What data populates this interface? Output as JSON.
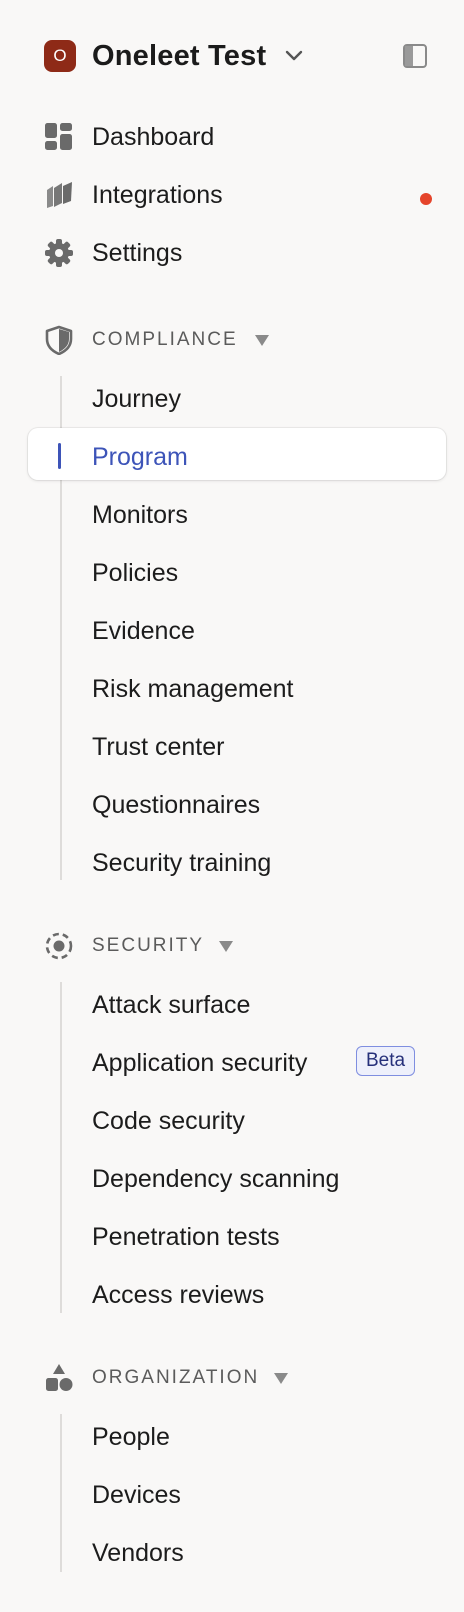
{
  "workspace": {
    "initial": "O",
    "name": "Oneleet Test",
    "chevron_icon": "chevron-down-icon",
    "toggle_icon": "sidebar-toggle-icon"
  },
  "nav": {
    "dashboard": "Dashboard",
    "integrations": "Integrations",
    "settings": "Settings"
  },
  "compliance": {
    "title": "COMPLIANCE",
    "items": [
      "Journey",
      "Program",
      "Monitors",
      "Policies",
      "Evidence",
      "Risk management",
      "Trust center",
      "Questionnaires",
      "Security training"
    ],
    "active": "Program"
  },
  "security": {
    "title": "SECURITY",
    "items": [
      "Attack surface",
      "Application security",
      "Code security",
      "Dependency scanning",
      "Penetration tests",
      "Access reviews"
    ],
    "badge": "Beta"
  },
  "organization": {
    "title": "ORGANIZATION",
    "items": [
      "People",
      "Devices",
      "Vendors"
    ]
  },
  "colors": {
    "brand_badge": "#8e2a17",
    "accent": "#3d54b8",
    "notification": "#e5442b",
    "background": "#f9f8f7"
  }
}
